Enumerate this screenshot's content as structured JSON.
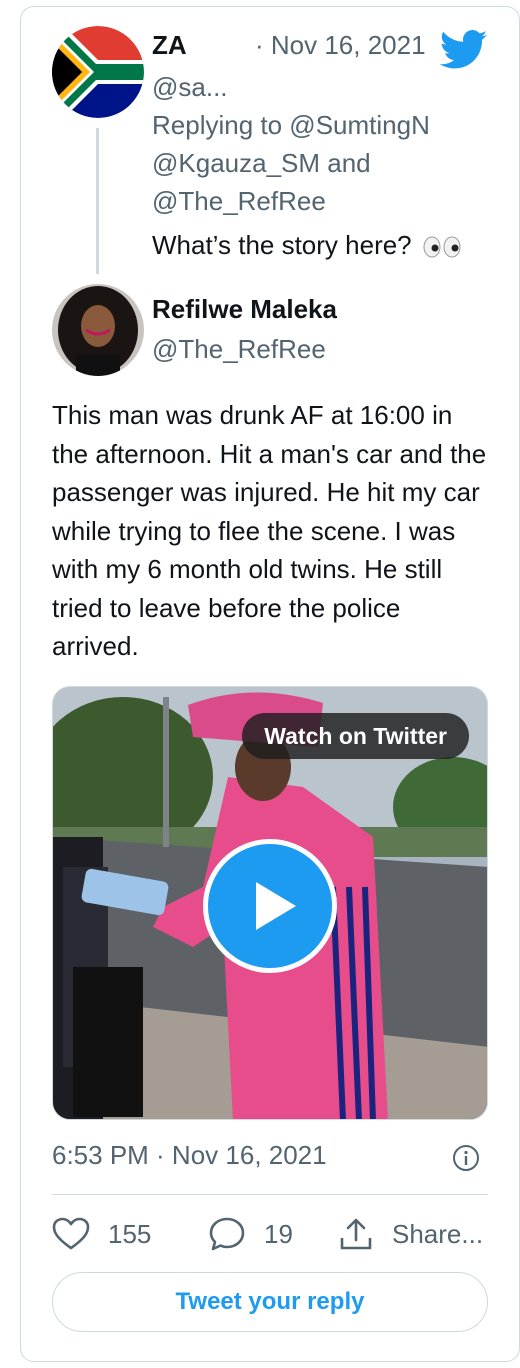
{
  "parent_tweet": {
    "name": "ZA",
    "date": "· Nov 16, 2021",
    "handle": "@sa...",
    "replying_to": "Replying to @SumtingN @Kgauza_SM and @The_RefRee",
    "text": "What’s the story here?",
    "avatar_icon": "south-africa-flag"
  },
  "main_tweet": {
    "name": "Refilwe Maleka",
    "handle": "@The_RefRee",
    "text": "This man was drunk AF at 16:00 in the afternoon. Hit a man's car and the passenger was injured. He hit my car while trying to flee the scene. I was with my 6 month old twins. He still tried to leave before the police arrived.",
    "avatar_icon": "profile-photo"
  },
  "video": {
    "watch_label": "Watch on Twitter",
    "play_icon": "play-icon"
  },
  "timestamp": "6:53 PM · Nov 16, 2021",
  "actions": {
    "likes": "155",
    "replies": "19",
    "share_label": "Share..."
  },
  "reply_button": "Tweet your reply",
  "colors": {
    "accent": "#1d9bf0",
    "muted": "#536471",
    "border": "#cfd9de"
  }
}
